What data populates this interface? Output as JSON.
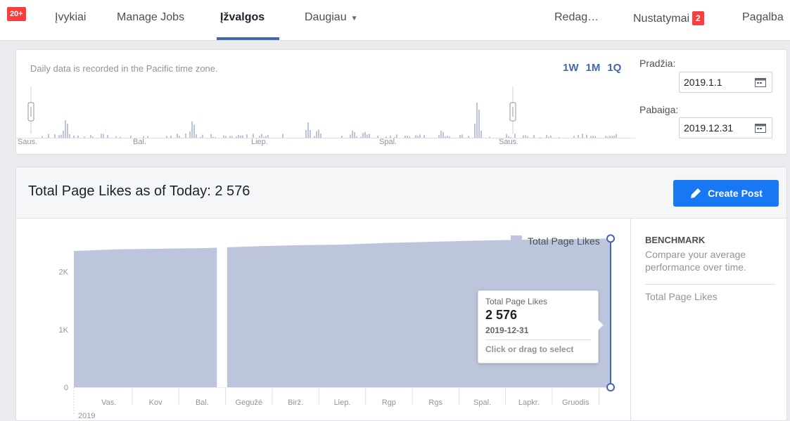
{
  "nav": {
    "notif_badge": "20+",
    "items": [
      "Įvykiai",
      "Manage Jobs",
      "Įžvalgos",
      "Daugiau"
    ],
    "right": {
      "edit": "Redag…",
      "settings": "Nustatymai",
      "settings_badge": "2",
      "help": "Pagalba"
    }
  },
  "timeline": {
    "note": "Daily data is recorded in the Pacific time zone.",
    "ranges": [
      "1W",
      "1M",
      "1Q"
    ],
    "months": [
      "Saus.",
      "Bal.",
      "Liep.",
      "Spal.",
      "Saus."
    ],
    "start_label": "Pradžia:",
    "start_value": "2019.1.1",
    "end_label": "Pabaiga:",
    "end_value": "2019.12.31"
  },
  "likes": {
    "title": "Total Page Likes as of Today: 2 576",
    "create_post": "Create Post",
    "legend": "Total Page Likes",
    "benchmark": {
      "title": "BENCHMARK",
      "desc": "Compare your average performance over time.",
      "item": "Total Page Likes"
    },
    "tooltip": {
      "label": "Total Page Likes",
      "value": "2 576",
      "date": "2019-12-31",
      "hint": "Click or drag to select"
    }
  },
  "chart_data": {
    "type": "area",
    "series": [
      {
        "name": "Total Page Likes",
        "color": "#bcc5dc"
      }
    ],
    "x": [
      "2019-01-01",
      "2019-02-01",
      "2019-03-01",
      "2019-04-01",
      "2019-04-10",
      "2019-05-01",
      "2019-06-01",
      "2019-07-01",
      "2019-08-01",
      "2019-09-01",
      "2019-10-01",
      "2019-11-01",
      "2019-12-01",
      "2019-12-31"
    ],
    "values": [
      2360,
      2390,
      2400,
      2410,
      2420,
      2440,
      2460,
      2470,
      2500,
      2520,
      2540,
      2555,
      2565,
      2576
    ],
    "gap": [
      "2019-04-08",
      "2019-04-15"
    ],
    "x_tick_labels": [
      "Vas.",
      "Kov",
      "Bal.",
      "Gegužė",
      "Birž.",
      "Liep.",
      "Rgp",
      "Rgs",
      "Spal.",
      "Lapkr.",
      "Gruodis"
    ],
    "year_label": "2019",
    "y_ticks": [
      {
        "value": 0,
        "label": "0"
      },
      {
        "value": 1000,
        "label": "1K"
      },
      {
        "value": 2000,
        "label": "2K"
      }
    ],
    "ylim": [
      0,
      2800
    ],
    "grid": true
  }
}
